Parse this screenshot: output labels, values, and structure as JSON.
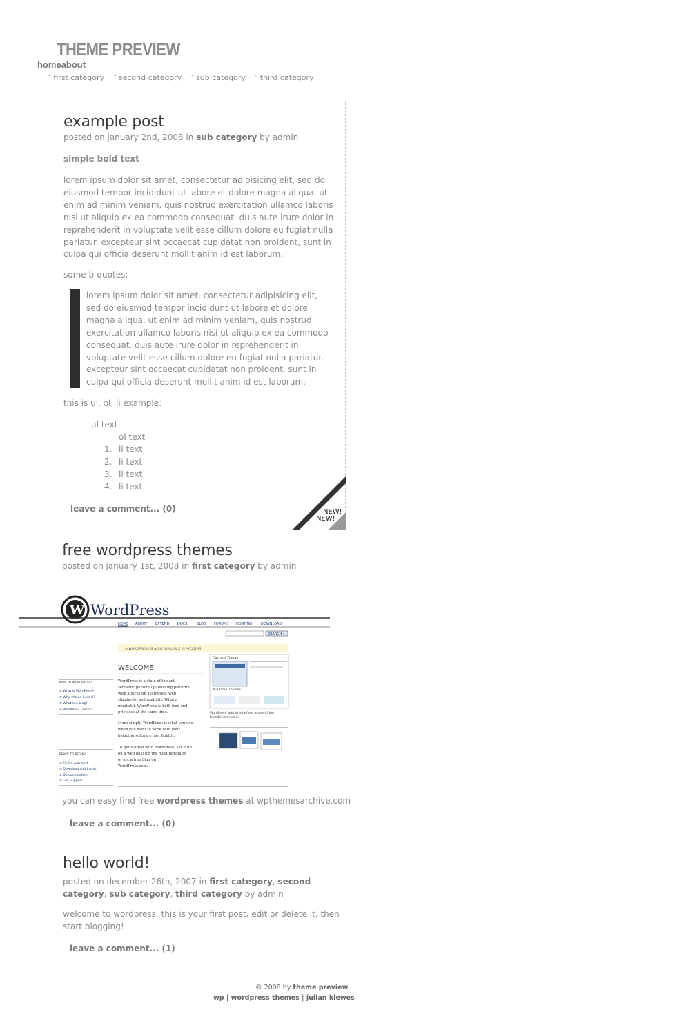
{
  "header": {
    "title": "THEME PREVIEW",
    "pages": [
      "home",
      "about"
    ],
    "categories": [
      "first category",
      "second category",
      "sub category",
      "third category"
    ]
  },
  "post1": {
    "title": "example post",
    "meta_prefix": "posted on january 2nd, 2008 in",
    "meta_category": "sub category",
    "meta_by": "by admin",
    "bold_text": "simple bold text",
    "para_lines": [
      "lorem ipsum dolor sit amet, consectetur adipisicing elit, sed do",
      "eiusmod tempor incididunt ut labore et dolore magna aliqua. ut",
      "enim ad minim veniam, quis nostrud exercitation ullamco laboris",
      "nisi ut aliquip ex ea commodo consequat. duis aute irure dolor in",
      "reprehenderit in voluptate velit esse cillum dolore eu fugiat nulla",
      "pariatur. excepteur sint occaecat cupidatat non proident, sunt in",
      "culpa qui officia deserunt mollit anim id est laborum."
    ],
    "bquote_label": "some b-quotes:",
    "bquote_lines": [
      "lorem ipsum dolor sit amet, consectetur adipisicing elit,",
      "sed do eiusmod tempor incididunt ut labore et dolore",
      "magna aliqua. ut enim ad minim veniam, quis nostrud",
      "exercitation ullamco laboris nisi ut aliquip ex ea commodo",
      "consequat. duis aute irure dolor in reprehenderit in",
      "voluptate velit esse cillum dolore eu fugiat nulla pariatur.",
      "excepteur sint occaecat cupidatat non proident, sunt in",
      "culpa qui officia deserunt mollit anim id est laborum."
    ],
    "list_label": "this is ul, ol, li example:",
    "ul_text": "ul text",
    "ol_text": "ol text",
    "li_items": [
      "li text",
      "li text",
      "li text",
      "li text"
    ],
    "li_numbers": [
      "1.",
      "2.",
      "3.",
      "4."
    ],
    "comment_link": "leave a comment... (0)",
    "new_badge": [
      "NEW!",
      "NEW!"
    ]
  },
  "post2": {
    "title": "free wordpress themes",
    "meta_prefix": "posted on january 1st, 2008 in",
    "meta_category": "first category",
    "meta_by": "by admin",
    "text_prefix": "you can easy find free",
    "text_bold": "wordpress themes",
    "text_suffix": "at wpthemesarchive.com",
    "comment_link": "leave a comment... (0)",
    "screenshot": {
      "logo": "WordPress",
      "nav": [
        "HOME",
        "ABOUT",
        "EXTEND",
        "DOCS",
        "BLOG",
        "FORUMS",
        "HOSTING",
        "DOWNLOAD"
      ],
      "search_button": "SEARCH »",
      "notice": "⊙ WORDPRESS IS ALSO AVAILABLE IN РУССКИЙ.",
      "welcome": "WELCOME",
      "new_to_wp": "NEW TO WORDPRESS?",
      "new_links": [
        "⊙ What is WordPress?",
        "⊙ Why should I use it?",
        "⊙ What is a blog?",
        "⊙ WordPress Lessons"
      ],
      "ready": "READY TO BEGIN?",
      "ready_links": [
        "⊙ Find a web host",
        "⊙ Download and Install",
        "⊙ Documentation",
        "⊙ Get Support"
      ],
      "body1": [
        "WordPress is a state-of-the-art",
        "semantic personal publishing platform",
        "with a focus on aesthetics, web",
        "standards, and usability. What a",
        "mouthful. WordPress is both free and",
        "priceless at the same time."
      ],
      "body2": [
        "More simply, WordPress is what you use",
        "when you want to work with your",
        "blogging software, not fight it."
      ],
      "body3": [
        "To get started with WordPress, set it up",
        "on a web host for the most flexibility",
        "or get a free blog on",
        "WordPress.com."
      ],
      "current_theme": "Current Theme",
      "available_themes": "Available Themes",
      "admin_caption": [
        "WordPress' admin interface is one of the",
        "friendliest around."
      ]
    }
  },
  "post3": {
    "title": "hello world!",
    "meta_prefix": "posted on december 26th, 2007 in",
    "cat1": "first category",
    "cat2a": "second",
    "cat2b": "category",
    "cat3": "sub category",
    "cat4": "third category",
    "meta_by": "by admin",
    "text_lines": [
      "welcome to wordpress. this is your first post. edit or delete it, then",
      "start blogging!"
    ],
    "comment_link": "leave a comment... (1)"
  },
  "footer": {
    "line1_prefix": "© 2008 by",
    "line1_bold": "theme preview",
    "line2": [
      "wp",
      "wordpress themes",
      "julian klewes"
    ]
  }
}
